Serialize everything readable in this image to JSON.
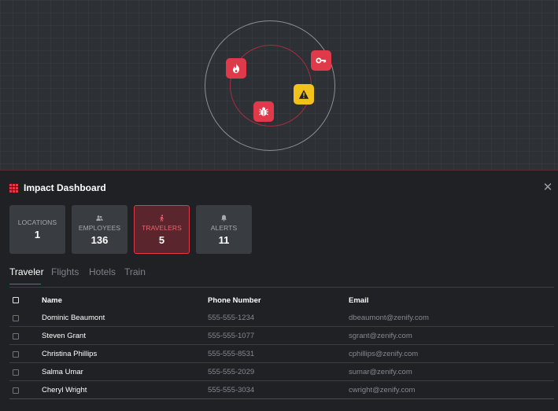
{
  "map": {
    "markers": [
      {
        "name": "fire-marker",
        "icon": "fire-icon",
        "color": "#e0394a"
      },
      {
        "name": "key-marker",
        "icon": "key-icon",
        "color": "#e0394a"
      },
      {
        "name": "warning-marker",
        "icon": "warning-icon",
        "color": "#f1c21b"
      },
      {
        "name": "bug-marker",
        "icon": "bug-icon",
        "color": "#e0394a"
      }
    ]
  },
  "panel": {
    "title": "Impact Dashboard",
    "icon": "grid-icon",
    "close_glyph": "✕"
  },
  "cards": [
    {
      "label": "LOCATIONS",
      "value": "1",
      "icon": "",
      "active": false
    },
    {
      "label": "EMPLOYEES",
      "value": "136",
      "icon": "people-icon",
      "active": false
    },
    {
      "label": "TRAVELERS",
      "value": "5",
      "icon": "walking-icon",
      "active": true
    },
    {
      "label": "ALERTS",
      "value": "11",
      "icon": "bell-icon",
      "active": false
    }
  ],
  "tabs": [
    "Traveler",
    "Flights",
    "Hotels",
    "Train"
  ],
  "active_tab": "Traveler",
  "table": {
    "headers": {
      "name": "Name",
      "phone": "Phone Number",
      "email": "Email"
    },
    "rows": [
      {
        "name": "Dominic Beaumont",
        "phone": "555-555-1234",
        "email": "dbeaumont@zenify.com"
      },
      {
        "name": "Steven Grant",
        "phone": "555-555-1077",
        "email": "sgrant@zenify.com"
      },
      {
        "name": "Christina Phillips",
        "phone": "555-555-8531",
        "email": "cphillips@zenify.com"
      },
      {
        "name": "Salma Umar",
        "phone": "555-555-2029",
        "email": "sumar@zenify.com"
      },
      {
        "name": "Cheryl Wright",
        "phone": "555-555-3034",
        "email": "cwright@zenify.com"
      }
    ]
  },
  "colors": {
    "accent": "#e0394a",
    "warning": "#f1c21b",
    "background": "#1f2125",
    "map_background": "#2d3034"
  }
}
